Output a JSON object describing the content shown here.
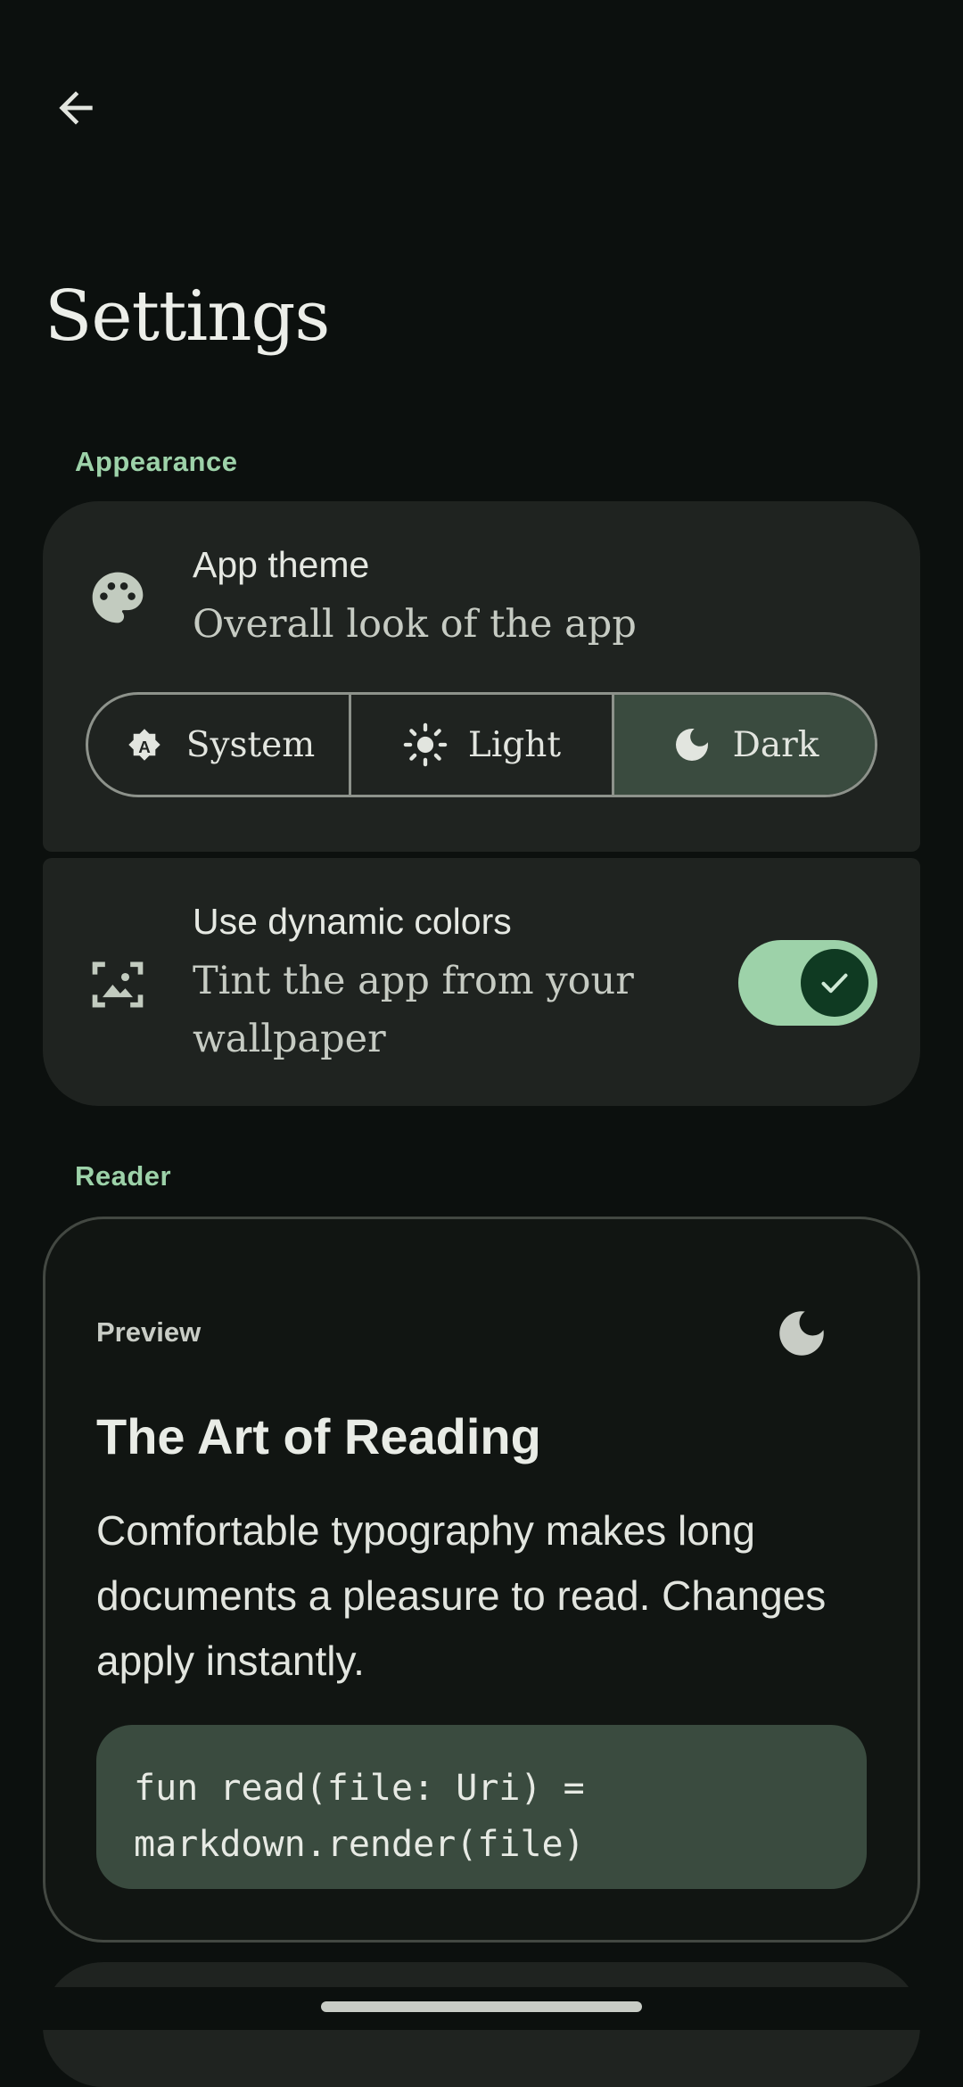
{
  "header": {
    "title": "Settings"
  },
  "sections": {
    "appearance": "Appearance",
    "reader": "Reader"
  },
  "app_theme": {
    "title": "App theme",
    "subtitle": "Overall look of the app",
    "options": [
      {
        "label": "System",
        "icon": "auto-theme-icon",
        "selected": false
      },
      {
        "label": "Light",
        "icon": "sun-icon",
        "selected": false
      },
      {
        "label": "Dark",
        "icon": "moon-icon",
        "selected": true
      }
    ]
  },
  "dynamic_colors": {
    "title": "Use dynamic colors",
    "subtitle_line1": "Tint the app from your",
    "subtitle_line2": "wallpaper",
    "enabled": true
  },
  "preview": {
    "label": "Preview",
    "heading": "The Art of Reading",
    "body_line1": "Comfortable typography makes long",
    "body_line2": "documents a pleasure to read. Changes",
    "body_line3": "apply instantly.",
    "code_line1": "fun read(file: Uri) =",
    "code_line2": "markdown.render(file)"
  },
  "colors": {
    "background": "#0c100e",
    "card": "#1f2320",
    "accent": "#9dd2a9",
    "selected_segment": "#3a4b3f",
    "toggle_knob": "#0f3a22"
  }
}
